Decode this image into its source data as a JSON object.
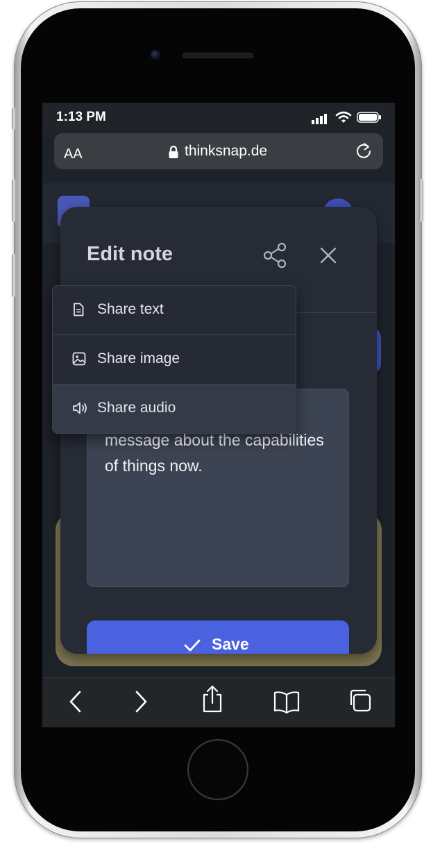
{
  "status_bar": {
    "time": "1:13 PM"
  },
  "browser": {
    "text_size_label": "AA",
    "url": "thinksnap.de"
  },
  "modal": {
    "title": "Edit note",
    "note_text": "message about the capabilities of things now.",
    "save_label": "Save"
  },
  "share_menu": {
    "items": [
      {
        "label": "Share text",
        "icon": "document-icon"
      },
      {
        "label": "Share image",
        "icon": "image-icon"
      },
      {
        "label": "Share audio",
        "icon": "speaker-icon"
      }
    ]
  },
  "toolbar": {
    "icons": [
      "back-icon",
      "forward-icon",
      "share-icon",
      "bookmarks-icon",
      "tabs-icon"
    ]
  },
  "colors": {
    "accent": "#4a61e0",
    "modal_bg": "#262b36",
    "gold_card": "#7c7450"
  }
}
